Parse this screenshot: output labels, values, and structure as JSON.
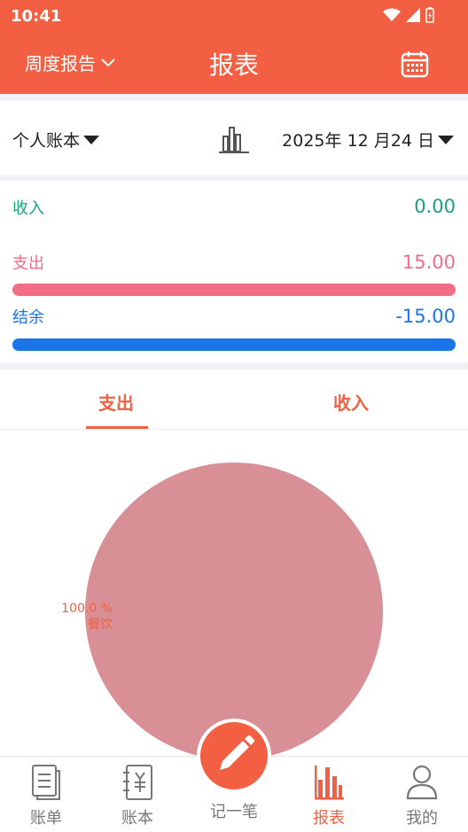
{
  "status": {
    "time": "10:41"
  },
  "header": {
    "report_type": "周度报告",
    "title": "报表"
  },
  "filter": {
    "book": "个人账本",
    "date": "2025年 12 月24 日"
  },
  "summary": {
    "income": {
      "label": "收入",
      "value": "0.00",
      "color": "#1aa37a"
    },
    "expense": {
      "label": "支出",
      "value": "15.00",
      "color": "#f36d86"
    },
    "balance": {
      "label": "结余",
      "value": "-15.00",
      "color": "#1b74e8"
    }
  },
  "tabs": [
    {
      "label": "支出",
      "active": true
    },
    {
      "label": "收入",
      "active": false
    }
  ],
  "chart_data": {
    "type": "pie",
    "slices": [
      {
        "label": "餐饮",
        "percent_label": "100.0 %",
        "value": 100.0,
        "color": "#d98f96"
      }
    ]
  },
  "nav": {
    "items": [
      {
        "label": "账单",
        "icon": "bill-icon"
      },
      {
        "label": "账本",
        "icon": "ledger-icon"
      },
      {
        "label": "记一笔",
        "icon": "pencil-icon"
      },
      {
        "label": "报表",
        "icon": "report-chart-icon",
        "active": true
      },
      {
        "label": "我的",
        "icon": "user-icon"
      }
    ]
  },
  "colors": {
    "accent": "#f25f42"
  }
}
